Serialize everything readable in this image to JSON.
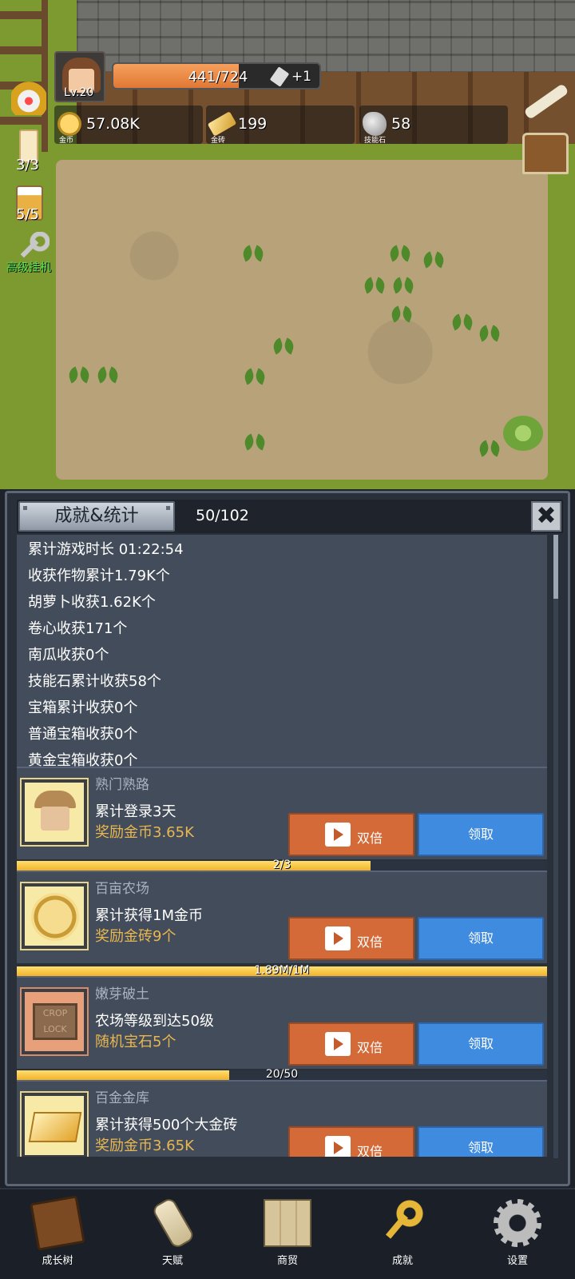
{
  "hud": {
    "level": "Lv.20",
    "hp_text": "441/724",
    "hp_fraction": 0.609,
    "hp_bonus": "+1",
    "coins": {
      "value": "57.08K",
      "caption": "金币"
    },
    "gold_bricks": {
      "value": "199",
      "caption": "金砖"
    },
    "skill_stones": {
      "value": "58",
      "caption": "技能石"
    },
    "candle_count": "3/3",
    "beer_count": "5/5",
    "idle_label": "高级挂机"
  },
  "panel": {
    "title": "成就&统计",
    "progress": "50/102",
    "close_symbol": "✖",
    "stats": [
      "累计游戏时长 01:22:54",
      "收获作物累计1.79K个",
      "胡萝卜收获1.62K个",
      "卷心收获171个",
      "南瓜收获0个",
      "技能石累计收获58个",
      "宝箱累计收获0个",
      "普通宝箱收获0个",
      "黄金宝箱收获0个"
    ],
    "achievements": [
      {
        "name": "熟门熟路",
        "desc": "累计登录3天",
        "reward": "奖励金币3.65K",
        "progress_text": "2/3",
        "progress_fraction": 0.667,
        "double_label": "双倍",
        "claim_label": "领取"
      },
      {
        "name": "百亩农场",
        "desc": "累计获得1M金币",
        "reward": "奖励金砖9个",
        "progress_text": "1.89M/1M",
        "progress_fraction": 1.0,
        "double_label": "双倍",
        "claim_label": "领取"
      },
      {
        "name": "嫩芽破土",
        "desc": "农场等级到达50级",
        "reward": "随机宝石5个",
        "progress_text": "20/50",
        "progress_fraction": 0.4,
        "double_label": "双倍",
        "claim_label": "领取",
        "icon_text": [
          "CROP",
          "LOCK"
        ]
      },
      {
        "name": "百金金库",
        "desc": "累计获得500个大金砖",
        "reward": "奖励金币3.65K",
        "double_label": "双倍",
        "claim_label": "领取"
      }
    ]
  },
  "nav": [
    {
      "label": "成长树",
      "icon": "book-icon"
    },
    {
      "label": "天赋",
      "icon": "scroll-icon"
    },
    {
      "label": "商贸",
      "icon": "map-icon"
    },
    {
      "label": "成就",
      "icon": "key-icon"
    },
    {
      "label": "设置",
      "icon": "gear-icon"
    }
  ]
}
